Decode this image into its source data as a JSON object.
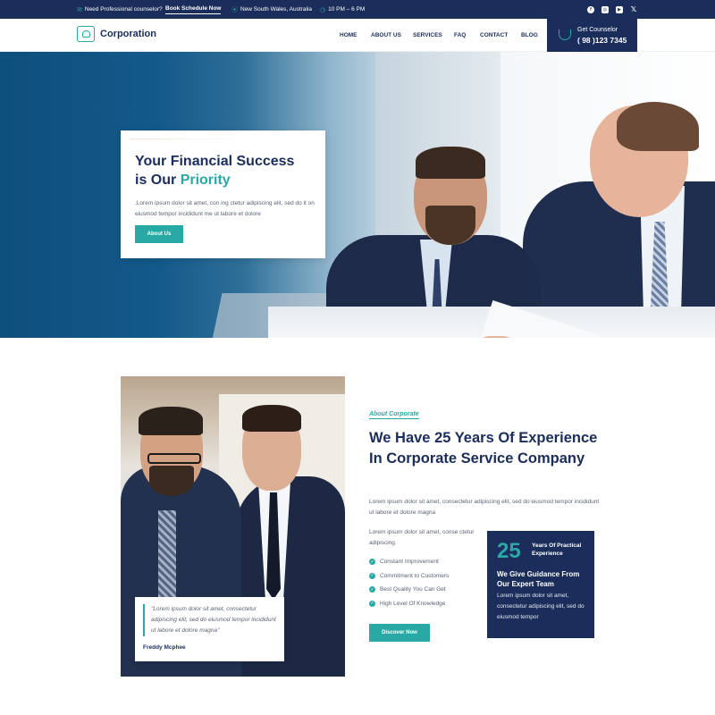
{
  "topbar": {
    "mail_text": "Need Professional counselor?",
    "schedule_link": "Book Schedule Now",
    "location": "New South Wales, Australia",
    "hours": "10 PM – 6 PM",
    "social": [
      "facebook-icon",
      "instagram-icon",
      "youtube-icon",
      "x-icon"
    ]
  },
  "nav": {
    "logo_text": "Corporation",
    "menu": [
      "HOME",
      "ABOUT US",
      "SERVICES",
      "FAQ",
      "CONTACT",
      "BLOG"
    ],
    "counselor_label": "Get Counselor",
    "counselor_phone": "( 98 )123 7345"
  },
  "hero": {
    "title_line1": "Your Financial Success",
    "title_prefix": "is Our",
    "title_highlight": "Priority",
    "text": ".Lorem ipsum dolor sit amet, con ing ctetur adipiscing elit, sed do it on eiusmod tempor incididunt me ut labore et dolore",
    "button": "About Us"
  },
  "about": {
    "quote": "\"Lorem ipsum dolor sit amet, consectetur adipiscing elit, sed do eiusmod tempor incididunt ut labore et dolore magna\"",
    "quote_author": "Freddy Mcphee",
    "tag": "About Corporate",
    "heading": "We Have 25 Years Of Experience In Corporate Service Company",
    "paragraph": "Lorem ipsum dolor sit amet, consectetur adipiscing elit, sed do eiusmod tempor incididunt ut labore et dolore magna",
    "paragraph2": "Lorem ipsum dolor sit amet, conse ctetur adipiscing.",
    "checks": [
      "Constant Improvement",
      "Commitment to Customers",
      "Best Quality You Can Get",
      "High Level Of Knowledge"
    ],
    "button": "Discover Now",
    "stat": {
      "number": "25",
      "label": "Years Of Practical Experience",
      "title": "We Give Guidance From Our Expert Team",
      "text": "Lorem ipsum dolor sit amet, consectetur adipiscing elit, sed do eiusmod tempor"
    }
  },
  "colors": {
    "navy": "#1b2d5a",
    "teal": "#28a9a5"
  }
}
